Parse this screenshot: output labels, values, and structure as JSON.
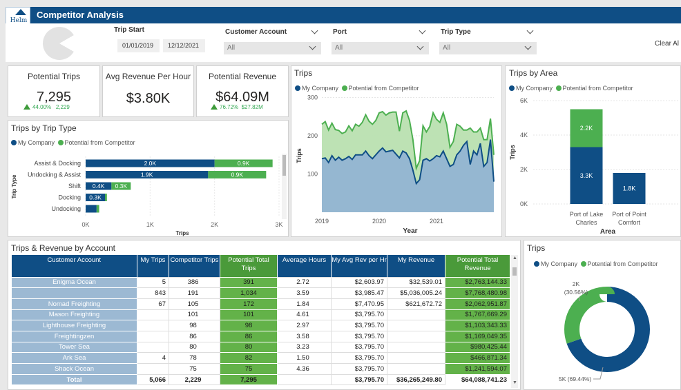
{
  "app": {
    "logo_text": "Helm",
    "title": "Competitor Analysis"
  },
  "filters": {
    "trip_start_label": "Trip Start",
    "date_from": "01/01/2019",
    "date_to": "12/12/2021",
    "customer_account": {
      "label": "Customer Account",
      "value": "All"
    },
    "port": {
      "label": "Port",
      "value": "All"
    },
    "trip_type": {
      "label": "Trip Type",
      "value": "All"
    },
    "clear_all": "Clear Al"
  },
  "kpis": {
    "potential_trips": {
      "label": "Potential Trips",
      "value": "7,295",
      "delta_pct": "44.00%",
      "delta_abs": "2,229"
    },
    "avg_revenue": {
      "label": "Avg Revenue Per Hour",
      "value": "$3.80K"
    },
    "potential_revenue": {
      "label": "Potential Revenue",
      "value": "$64.09M",
      "delta_pct": "76.72%",
      "delta_abs": "$27.82M"
    }
  },
  "legend": {
    "my_company": "My Company",
    "competitor": "Potential from Competitor"
  },
  "colors": {
    "my_company": "#0f4e85",
    "competitor": "#4caf50",
    "header": "#0f4e85"
  },
  "trip_type_chart": {
    "title": "Trips by Trip Type",
    "chart_data": {
      "type": "bar",
      "orientation": "horizontal",
      "stacked": true,
      "categories": [
        "Assist & Docking",
        "Undocking & Assist",
        "Shift",
        "Docking",
        "Undocking"
      ],
      "series": [
        {
          "name": "My Company",
          "values": [
            2000,
            1900,
            400,
            300,
            170
          ],
          "labels": [
            "2.0K",
            "1.9K",
            "0.4K",
            "0.3K",
            ""
          ]
        },
        {
          "name": "Potential from Competitor",
          "values": [
            900,
            900,
            300,
            30,
            40
          ],
          "labels": [
            "0.9K",
            "0.9K",
            "0.3K",
            "",
            ""
          ]
        }
      ],
      "xlabel": "Trips",
      "ylabel": "Trip Type",
      "xticks": [
        "0K",
        "1K",
        "2K",
        "3K"
      ],
      "xlim": [
        0,
        3000
      ]
    }
  },
  "trips_chart": {
    "title": "Trips",
    "chart_data": {
      "type": "area",
      "stacked": true,
      "x_start": "2019-01",
      "series": [
        {
          "name": "My Company",
          "values": [
            140,
            142,
            130,
            148,
            136,
            144,
            136,
            140,
            146,
            138,
            150,
            150,
            150,
            160,
            148,
            140,
            150,
            160,
            168,
            158,
            160,
            162,
            152,
            142,
            160,
            155,
            140,
            110,
            75,
            85,
            136,
            140,
            134,
            140,
            148,
            145,
            160,
            140,
            120,
            125,
            150,
            160,
            175,
            185,
            125,
            160,
            150,
            180,
            120,
            130,
            190,
            80
          ]
        },
        {
          "name": "Potential from Competitor",
          "values": [
            90,
            95,
            85,
            85,
            80,
            70,
            70,
            70,
            80,
            75,
            80,
            75,
            85,
            95,
            90,
            90,
            90,
            100,
            95,
            96,
            100,
            100,
            110,
            70,
            100,
            110,
            100,
            80,
            40,
            50,
            90,
            70,
            90,
            120,
            95,
            90,
            100,
            90,
            50,
            60,
            80,
            65,
            40,
            30,
            95,
            50,
            60,
            40,
            70,
            60,
            55,
            70
          ]
        }
      ],
      "xticks": [
        "2019",
        "2020",
        "2021"
      ],
      "yticks": [
        "100",
        "200",
        "300"
      ],
      "xlabel": "Year",
      "ylabel": "Trips",
      "ylim": [
        0,
        310
      ]
    }
  },
  "area_chart": {
    "title": "Trips by Area",
    "chart_data": {
      "type": "bar",
      "stacked": true,
      "categories": [
        "Port of Lake Charles",
        "Port of Point Comfort"
      ],
      "category_lines": [
        [
          "Port of Lake",
          "Charles"
        ],
        [
          "Port of Point",
          "Comfort"
        ]
      ],
      "series": [
        {
          "name": "My Company",
          "values": [
            3300,
            1800
          ],
          "labels": [
            "3.3K",
            "1.8K"
          ]
        },
        {
          "name": "Potential from Competitor",
          "values": [
            2200,
            0
          ],
          "labels": [
            "2.2K",
            ""
          ]
        }
      ],
      "yticks": [
        "0K",
        "2K",
        "4K",
        "6K"
      ],
      "xlabel": "Area",
      "ylabel": "Trips",
      "ylim": [
        0,
        6000
      ]
    }
  },
  "donut_chart": {
    "title": "Trips",
    "chart_data": {
      "type": "pie",
      "donut": true,
      "slices": [
        {
          "name": "My Company",
          "value": 5000,
          "pct": 69.44,
          "label": "5K (69.44%)"
        },
        {
          "name": "Potential from Competitor",
          "value": 2000,
          "pct": 30.56,
          "label_lines": [
            "2K",
            "(30.56%)"
          ]
        }
      ]
    }
  },
  "table": {
    "title": "Trips & Revenue by Account",
    "columns": [
      "Customer Account",
      "My Trips",
      "Competitor Trips",
      "Potential Total Trips",
      "Average Hours",
      "My Avg Rev per Hr",
      "My Revenue",
      "Potential Total Revenue"
    ],
    "rows": [
      [
        "Enigma Ocean",
        "5",
        "386",
        "391",
        "2.72",
        "$2,603.97",
        "$32,539.01",
        "$2,763,144.33"
      ],
      [
        "",
        "843",
        "191",
        "1,034",
        "3.59",
        "$3,985.47",
        "$5,036,005.24",
        "$7,768,480.98"
      ],
      [
        "Nomad Freighting",
        "67",
        "105",
        "172",
        "1.84",
        "$7,470.95",
        "$621,672.72",
        "$2,062,951.87"
      ],
      [
        "Mason Freighting",
        "",
        "101",
        "101",
        "4.61",
        "$3,795.70",
        "",
        "$1,767,669.29"
      ],
      [
        "Lighthouse Freighting",
        "",
        "98",
        "98",
        "2.97",
        "$3,795.70",
        "",
        "$1,103,343.33"
      ],
      [
        "Freightingzen",
        "",
        "86",
        "86",
        "3.58",
        "$3,795.70",
        "",
        "$1,169,049.35"
      ],
      [
        "Tower Sea",
        "",
        "80",
        "80",
        "3.23",
        "$3,795.70",
        "",
        "$980,425.44"
      ],
      [
        "Ark Sea",
        "4",
        "78",
        "82",
        "1.50",
        "$3,795.70",
        "",
        "$466,871.34"
      ],
      [
        "Shack Ocean",
        "",
        "75",
        "75",
        "4.36",
        "$3,795.70",
        "",
        "$1,241,594.07"
      ]
    ],
    "total": [
      "Total",
      "5,066",
      "2,229",
      "7,295",
      "",
      "$3,795.70",
      "$36,265,249.80",
      "$64,088,741.23"
    ]
  }
}
